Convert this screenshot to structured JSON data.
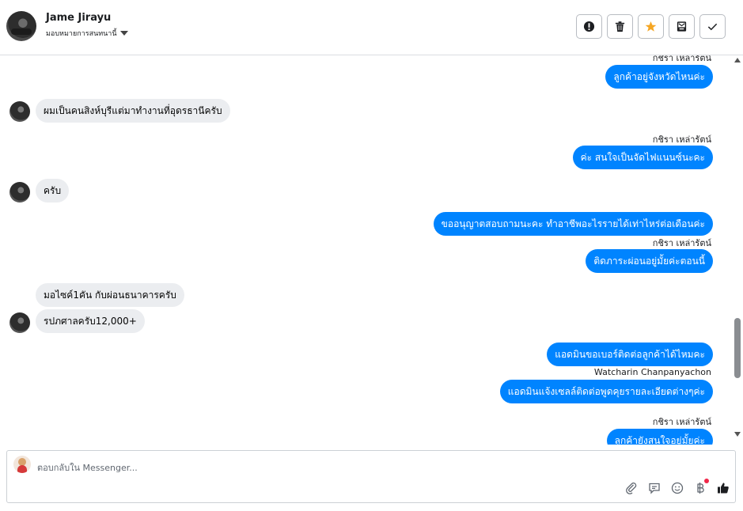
{
  "header": {
    "contact_name": "Jame Jirayu",
    "assign_label": "มอบหมายการสนทนานี้",
    "toolbar": [
      {
        "name": "report-spam-button",
        "icon": "alert-icon"
      },
      {
        "name": "delete-button",
        "icon": "trash-icon"
      },
      {
        "name": "star-button",
        "icon": "star-icon"
      },
      {
        "name": "move-inbox-button",
        "icon": "inbox-icon"
      },
      {
        "name": "mark-done-button",
        "icon": "check-icon"
      }
    ]
  },
  "messages": {
    "sender_1": "กชิรา เหล่ารัตน์",
    "out_1": "ลูกค้าอยู่จังหวัดไหนค่ะ",
    "in_1": "ผมเป็นคนสิงห์บุรีแต่มาทำงานที่อุดรธานีครับ",
    "sender_2": "กชิรา เหล่ารัตน์",
    "out_2": "ค่ะ สนใจเป็นจัดไฟแนนซ์นะคะ",
    "in_2": "ครับ",
    "out_3": "ขออนุญาตสอบถามนะคะ ทำอาชีพอะไรรายได้เท่าไหร่ต่อเดือนค่ะ",
    "sender_3": "กชิรา เหล่ารัตน์",
    "out_4": "ติดภาระผ่อนอยู่มั้ยค่ะตอนนี้",
    "in_3": "มอไซค์1คัน กับผ่อนธนาคารครับ",
    "in_4": "รปภศาลครับ12,000+",
    "out_5": "แอดมินขอเบอร์ติดต่อลูกค้าได้ไหมคะ",
    "sender_4": "Watcharin Chanpanyachon",
    "out_6": "แอดมินแจ้งเซลล์ติดต่อพูดคุยรายละเอียดต่างๆค่ะ",
    "sender_5": "กชิรา เหล่ารัตน์",
    "out_7": "ลูกค้ายังสนใจอยู่มั้ยค่ะ"
  },
  "composer": {
    "placeholder": "ตอบกลับใน Messenger..."
  },
  "colors": {
    "outgoing_bubble": "#0084ff",
    "incoming_bubble": "#ebedf0",
    "star": "#f5a623"
  }
}
